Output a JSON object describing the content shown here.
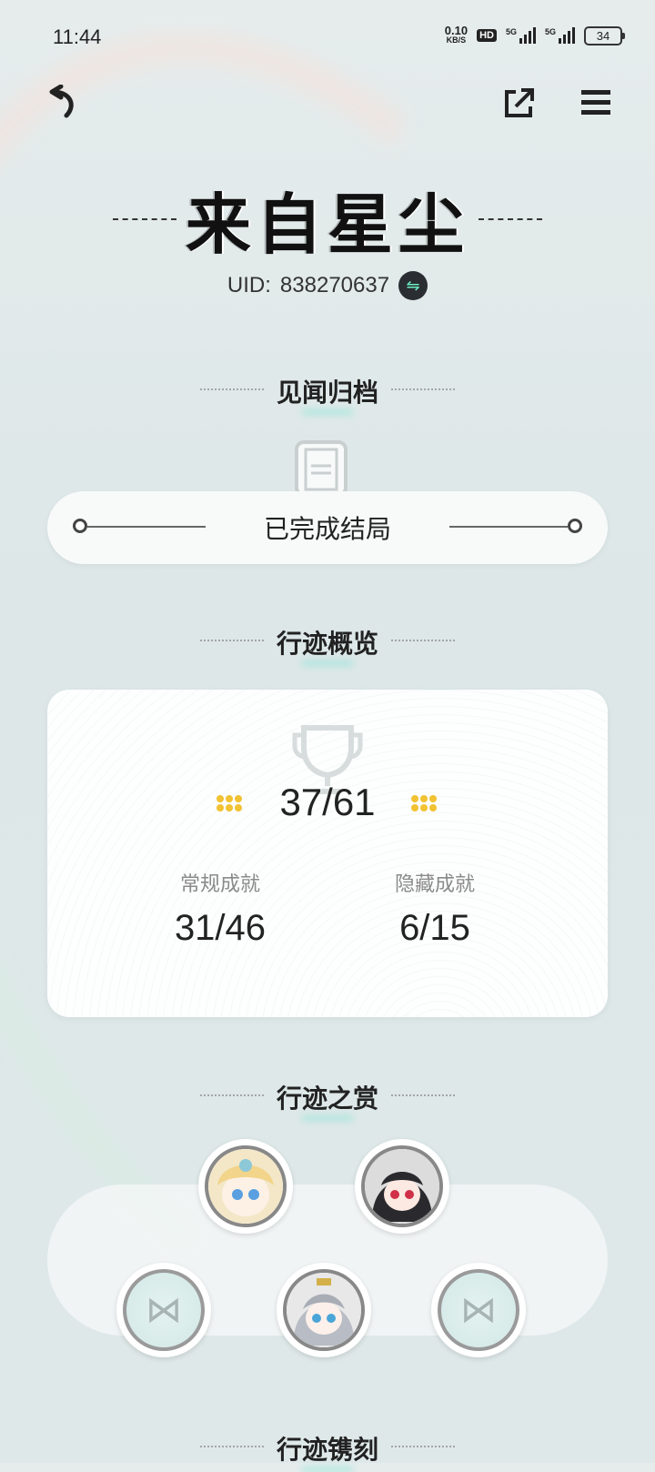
{
  "status_bar": {
    "time": "11:44",
    "net_speed": "0.10",
    "net_unit": "KB/S",
    "hd": "HD",
    "signal1": "5G",
    "signal2": "5G",
    "battery": "34"
  },
  "header": {
    "title": "来自星尘",
    "uid_label": "UID:",
    "uid_value": "838270637"
  },
  "archive": {
    "section_title": "见闻归档",
    "ending_label": "已完成结局"
  },
  "overview": {
    "section_title": "行迹概览",
    "total": "37/61",
    "regular_label": "常规成就",
    "regular_value": "31/46",
    "hidden_label": "隐藏成就",
    "hidden_value": "6/15"
  },
  "rewards": {
    "section_title": "行迹之赏"
  },
  "engraving": {
    "section_title": "行迹镌刻"
  },
  "colors": {
    "accent_teal": "#6cf0c0",
    "gold": "#f1c232"
  },
  "icons": {
    "back": "back-arrow-icon",
    "share": "share-icon",
    "menu": "menu-icon",
    "swap": "swap-icon",
    "trophy": "trophy-icon",
    "book": "book-icon",
    "locked": "locked-bowtie-icon"
  }
}
